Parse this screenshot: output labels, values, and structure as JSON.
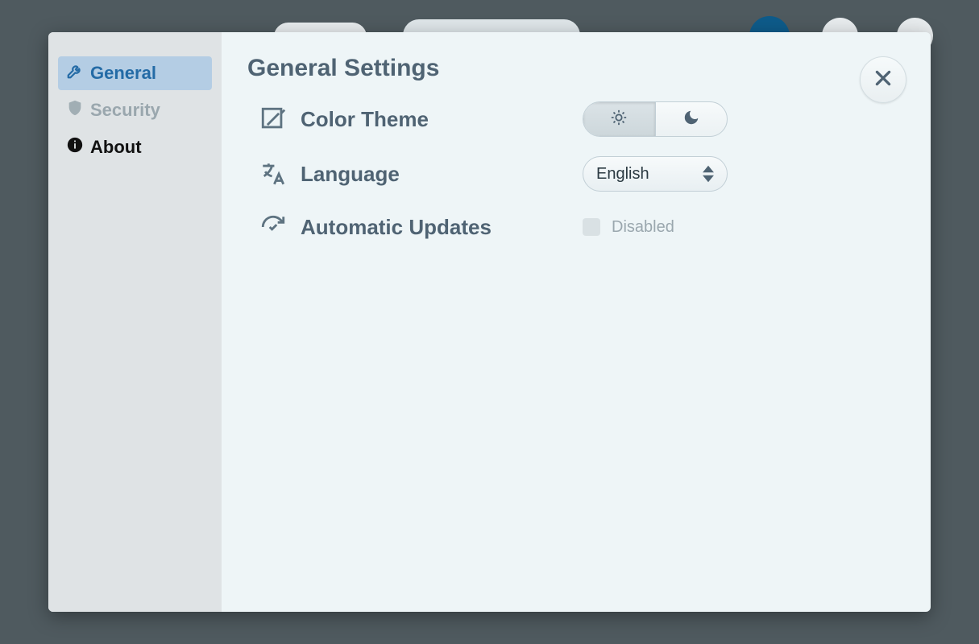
{
  "sidebar": {
    "items": [
      {
        "label": "General"
      },
      {
        "label": "Security"
      },
      {
        "label": "About"
      }
    ]
  },
  "page": {
    "title": "General Settings"
  },
  "settings": {
    "color_theme": {
      "label": "Color Theme",
      "selected": "light"
    },
    "language": {
      "label": "Language",
      "value": "English"
    },
    "auto_updates": {
      "label": "Automatic Updates",
      "status": "Disabled",
      "enabled": false
    }
  }
}
